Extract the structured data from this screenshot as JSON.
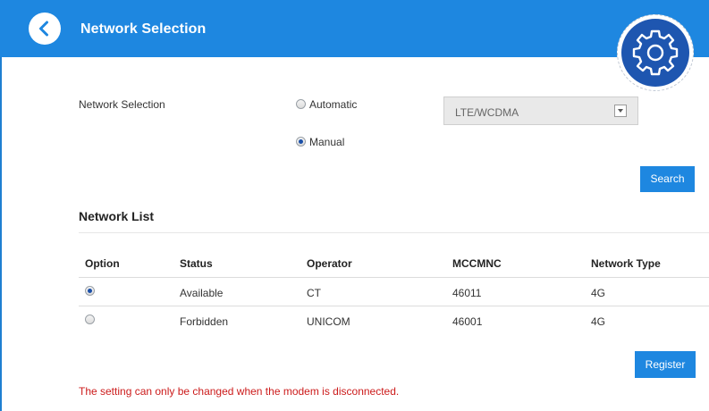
{
  "header": {
    "title": "Network Selection",
    "back_icon": "chevron-left-icon",
    "settings_icon": "gear-icon",
    "color": "#1e87e0"
  },
  "network_selection": {
    "label": "Network Selection",
    "mode_options": [
      {
        "label": "Automatic",
        "selected": false
      },
      {
        "label": "Manual",
        "selected": true
      }
    ],
    "network_type_select": {
      "value": "LTE/WCDMA"
    },
    "search_label": "Search"
  },
  "network_list": {
    "title": "Network List",
    "columns": [
      "Option",
      "Status",
      "Operator",
      "MCCMNC",
      "Network Type"
    ],
    "rows": [
      {
        "selected": true,
        "status": "Available",
        "operator": "CT",
        "mccmnc": "46011",
        "type": "4G"
      },
      {
        "selected": false,
        "status": "Forbidden",
        "operator": "UNICOM",
        "mccmnc": "46001",
        "type": "4G"
      }
    ],
    "register_label": "Register"
  },
  "warning": {
    "text": "The setting can only be changed when the modem is disconnected.",
    "color": "#cc1b1b"
  }
}
